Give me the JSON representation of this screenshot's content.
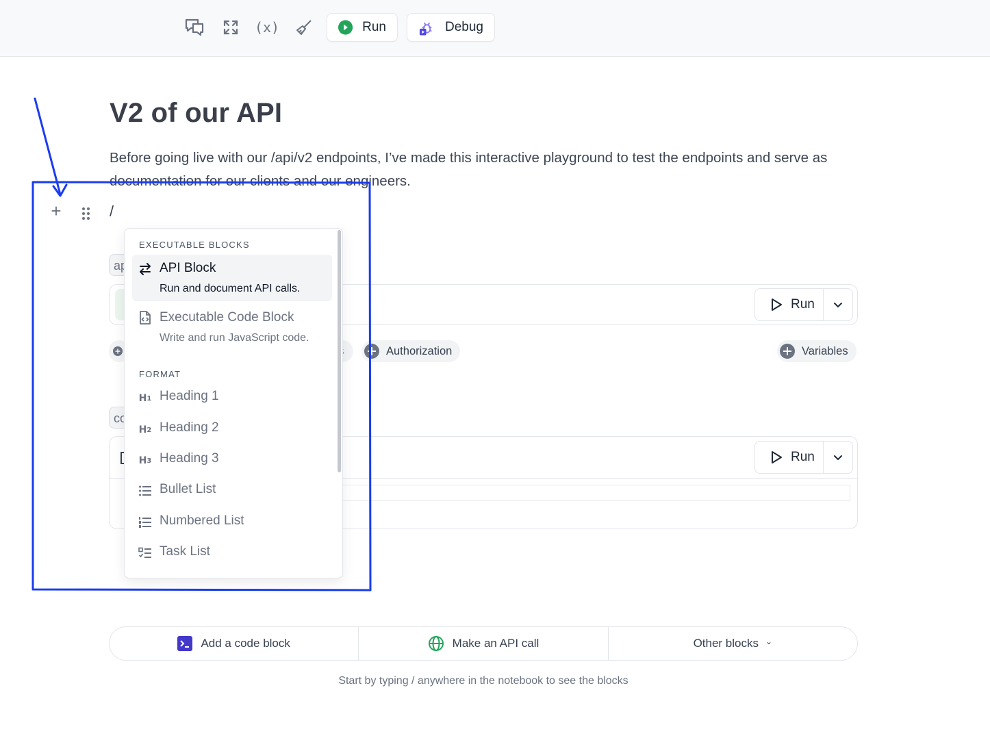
{
  "toolbar": {
    "run_label": "Run",
    "debug_label": "Debug",
    "variables_icon_text": "(x)",
    "icons": [
      "comment-icon",
      "fullscreen-icon",
      "variables-icon",
      "brush-icon"
    ],
    "run_icon_color": "#22a55b",
    "debug_icon_color": "#4f46e5"
  },
  "doc": {
    "title": "V2 of our API",
    "paragraph": "Before going live with our /api/v2 endpoints, I’ve made this interactive playground to test the endpoints and serve as documentation for our clients and our engineers.",
    "slash": "/"
  },
  "blocks": {
    "api_tag": "ap",
    "code_tag": "co",
    "run_label": "Run",
    "chips": {
      "partial": "s",
      "authorization": "Authorization",
      "variables": "Variables"
    }
  },
  "menu": {
    "sections": {
      "executable": "EXECUTABLE BLOCKS",
      "format": "FORMAT"
    },
    "executable_items": [
      {
        "title": "API Block",
        "desc": "Run and document API calls."
      },
      {
        "title": "Executable Code Block",
        "desc": "Write and run JavaScript code."
      }
    ],
    "format_items": [
      {
        "title": "Heading 1",
        "icon": "H1"
      },
      {
        "title": "Heading 2",
        "icon": "H2"
      },
      {
        "title": "Heading 3",
        "icon": "H3"
      },
      {
        "title": "Bullet List"
      },
      {
        "title": "Numbered List"
      },
      {
        "title": "Task List"
      }
    ]
  },
  "addbar": {
    "code_block": "Add a code block",
    "api_call": "Make an API call",
    "other_blocks": "Other blocks",
    "chevron": "⌄"
  },
  "hint": "Start by typing / anywhere in the notebook to see the blocks",
  "colors": {
    "annotation": "#1a3cf0",
    "api_icon": "#22a55b",
    "code_icon": "#4338ca"
  }
}
